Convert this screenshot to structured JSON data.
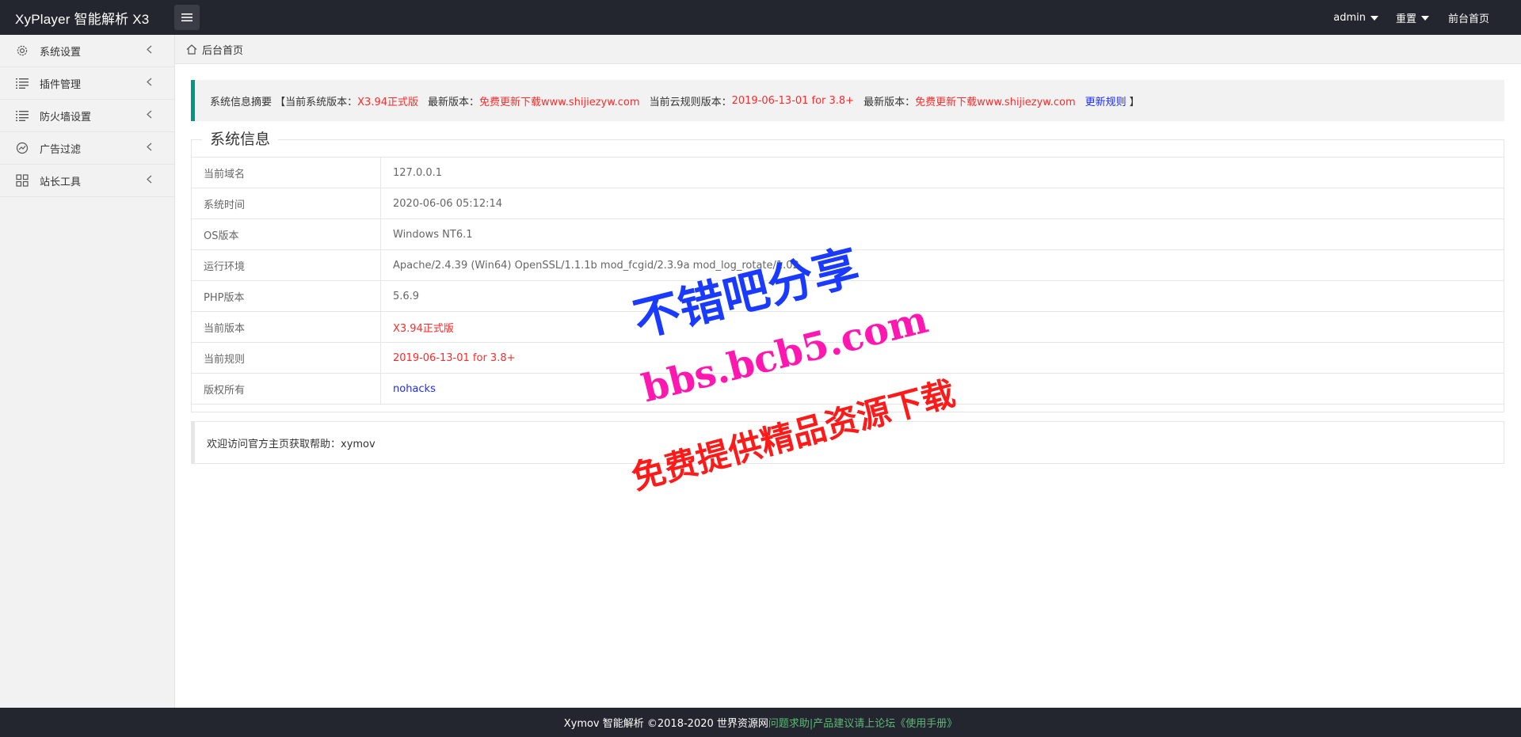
{
  "header": {
    "title": "XyPlayer 智能解析 X3",
    "menu_icon": "hamburger-icon",
    "nav": {
      "admin": "admin",
      "reset": "重置",
      "front": "前台首页"
    }
  },
  "sidebar": {
    "items": [
      {
        "label": "系统设置",
        "icon": "gear-icon"
      },
      {
        "label": "插件管理",
        "icon": "list-icon"
      },
      {
        "label": "防火墙设置",
        "icon": "list-icon"
      },
      {
        "label": "广告过滤",
        "icon": "chart-icon"
      },
      {
        "label": "站长工具",
        "icon": "grid-icon"
      }
    ]
  },
  "breadcrumb": {
    "label": "后台首页"
  },
  "notice": {
    "prefix": "系统信息摘要 【当前系统版本：",
    "current_version": "X3.94正式版",
    "latest_label": "最新版本：",
    "latest_link": "免费更新下载www.shijiezyw.com",
    "rule_label": "当前云规则版本：",
    "rule_version": "2019-06-13-01 for 3.8+",
    "latest_label2": "最新版本：",
    "latest_link2": "免费更新下载www.shijiezyw.com",
    "update_rules": "更新规则",
    "suffix": "】"
  },
  "system_info": {
    "legend": "系统信息",
    "rows": [
      {
        "key": "当前域名",
        "value": "127.0.0.1"
      },
      {
        "key": "系统时间",
        "value": "2020-06-06 05:12:14"
      },
      {
        "key": "OS版本",
        "value": "Windows NT6.1"
      },
      {
        "key": "运行环境",
        "value": "Apache/2.4.39 (Win64) OpenSSL/1.1.1b mod_fcgid/2.3.9a mod_log_rotate/1.02"
      },
      {
        "key": "PHP版本",
        "value": "5.6.9"
      },
      {
        "key": "当前版本",
        "value": "X3.94正式版"
      },
      {
        "key": "当前规则",
        "value": "2019-06-13-01 for 3.8+"
      },
      {
        "key": "版权所有",
        "value": "nohacks"
      }
    ]
  },
  "help": {
    "text": "欢迎访问官方主页获取帮助：xymov"
  },
  "watermark": {
    "line1": "不错吧分享",
    "line2": "bbs.bcb5.com",
    "line3": "免费提供精品资源下载"
  },
  "footer": {
    "text": "Xymov 智能解析 ©2018-2020 世界资源网 ",
    "link": "问题求助|产品建议请上论坛《使用手册》"
  },
  "colors": {
    "header_bg": "#23262e",
    "accent": "#009688",
    "red": "#ff2a2a",
    "blue": "#1e2cff",
    "footer_link": "#5fb878"
  }
}
